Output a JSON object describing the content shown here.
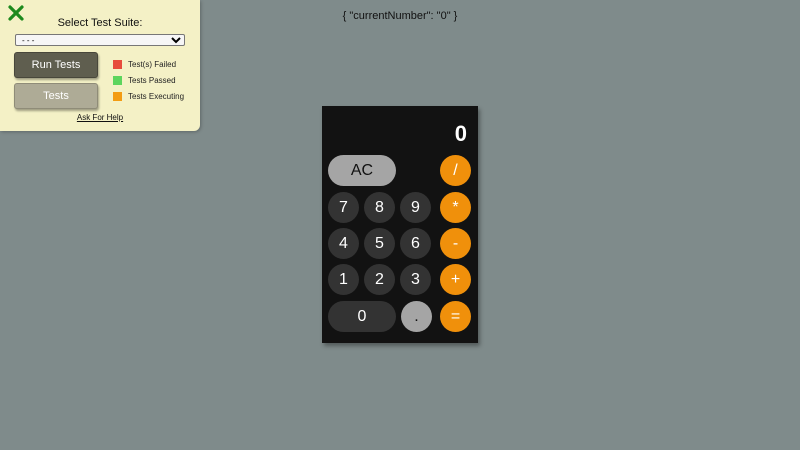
{
  "test_panel": {
    "close_icon": "close-x-icon",
    "suite_label": "Select Test Suite:",
    "suite_select_value": "- - -",
    "run_tests_label": "Run Tests",
    "tests_label": "Tests",
    "legend": [
      {
        "label": "Test(s) Failed",
        "color": "#e74c3c"
      },
      {
        "label": "Tests Passed",
        "color": "#5dd55d"
      },
      {
        "label": "Tests Executing",
        "color": "#f39c12"
      }
    ],
    "help_link": "Ask For Help"
  },
  "state_text": "{ \"currentNumber\": \"0\" }",
  "calculator": {
    "display": "0",
    "keys": {
      "clear": "AC",
      "divide": "/",
      "seven": "7",
      "eight": "8",
      "nine": "9",
      "multiply": "*",
      "four": "4",
      "five": "5",
      "six": "6",
      "subtract": "-",
      "one": "1",
      "two": "2",
      "three": "3",
      "add": "+",
      "zero": "0",
      "decimal": ".",
      "equals": "="
    }
  },
  "colors": {
    "background": "#7f8b8b",
    "panel": "#f4f1c6",
    "calculator_body": "#121212",
    "digit_key": "#333333",
    "function_key": "#a5a5a5",
    "operator_key": "#f0900b",
    "close_icon": "#1d8a1d"
  }
}
